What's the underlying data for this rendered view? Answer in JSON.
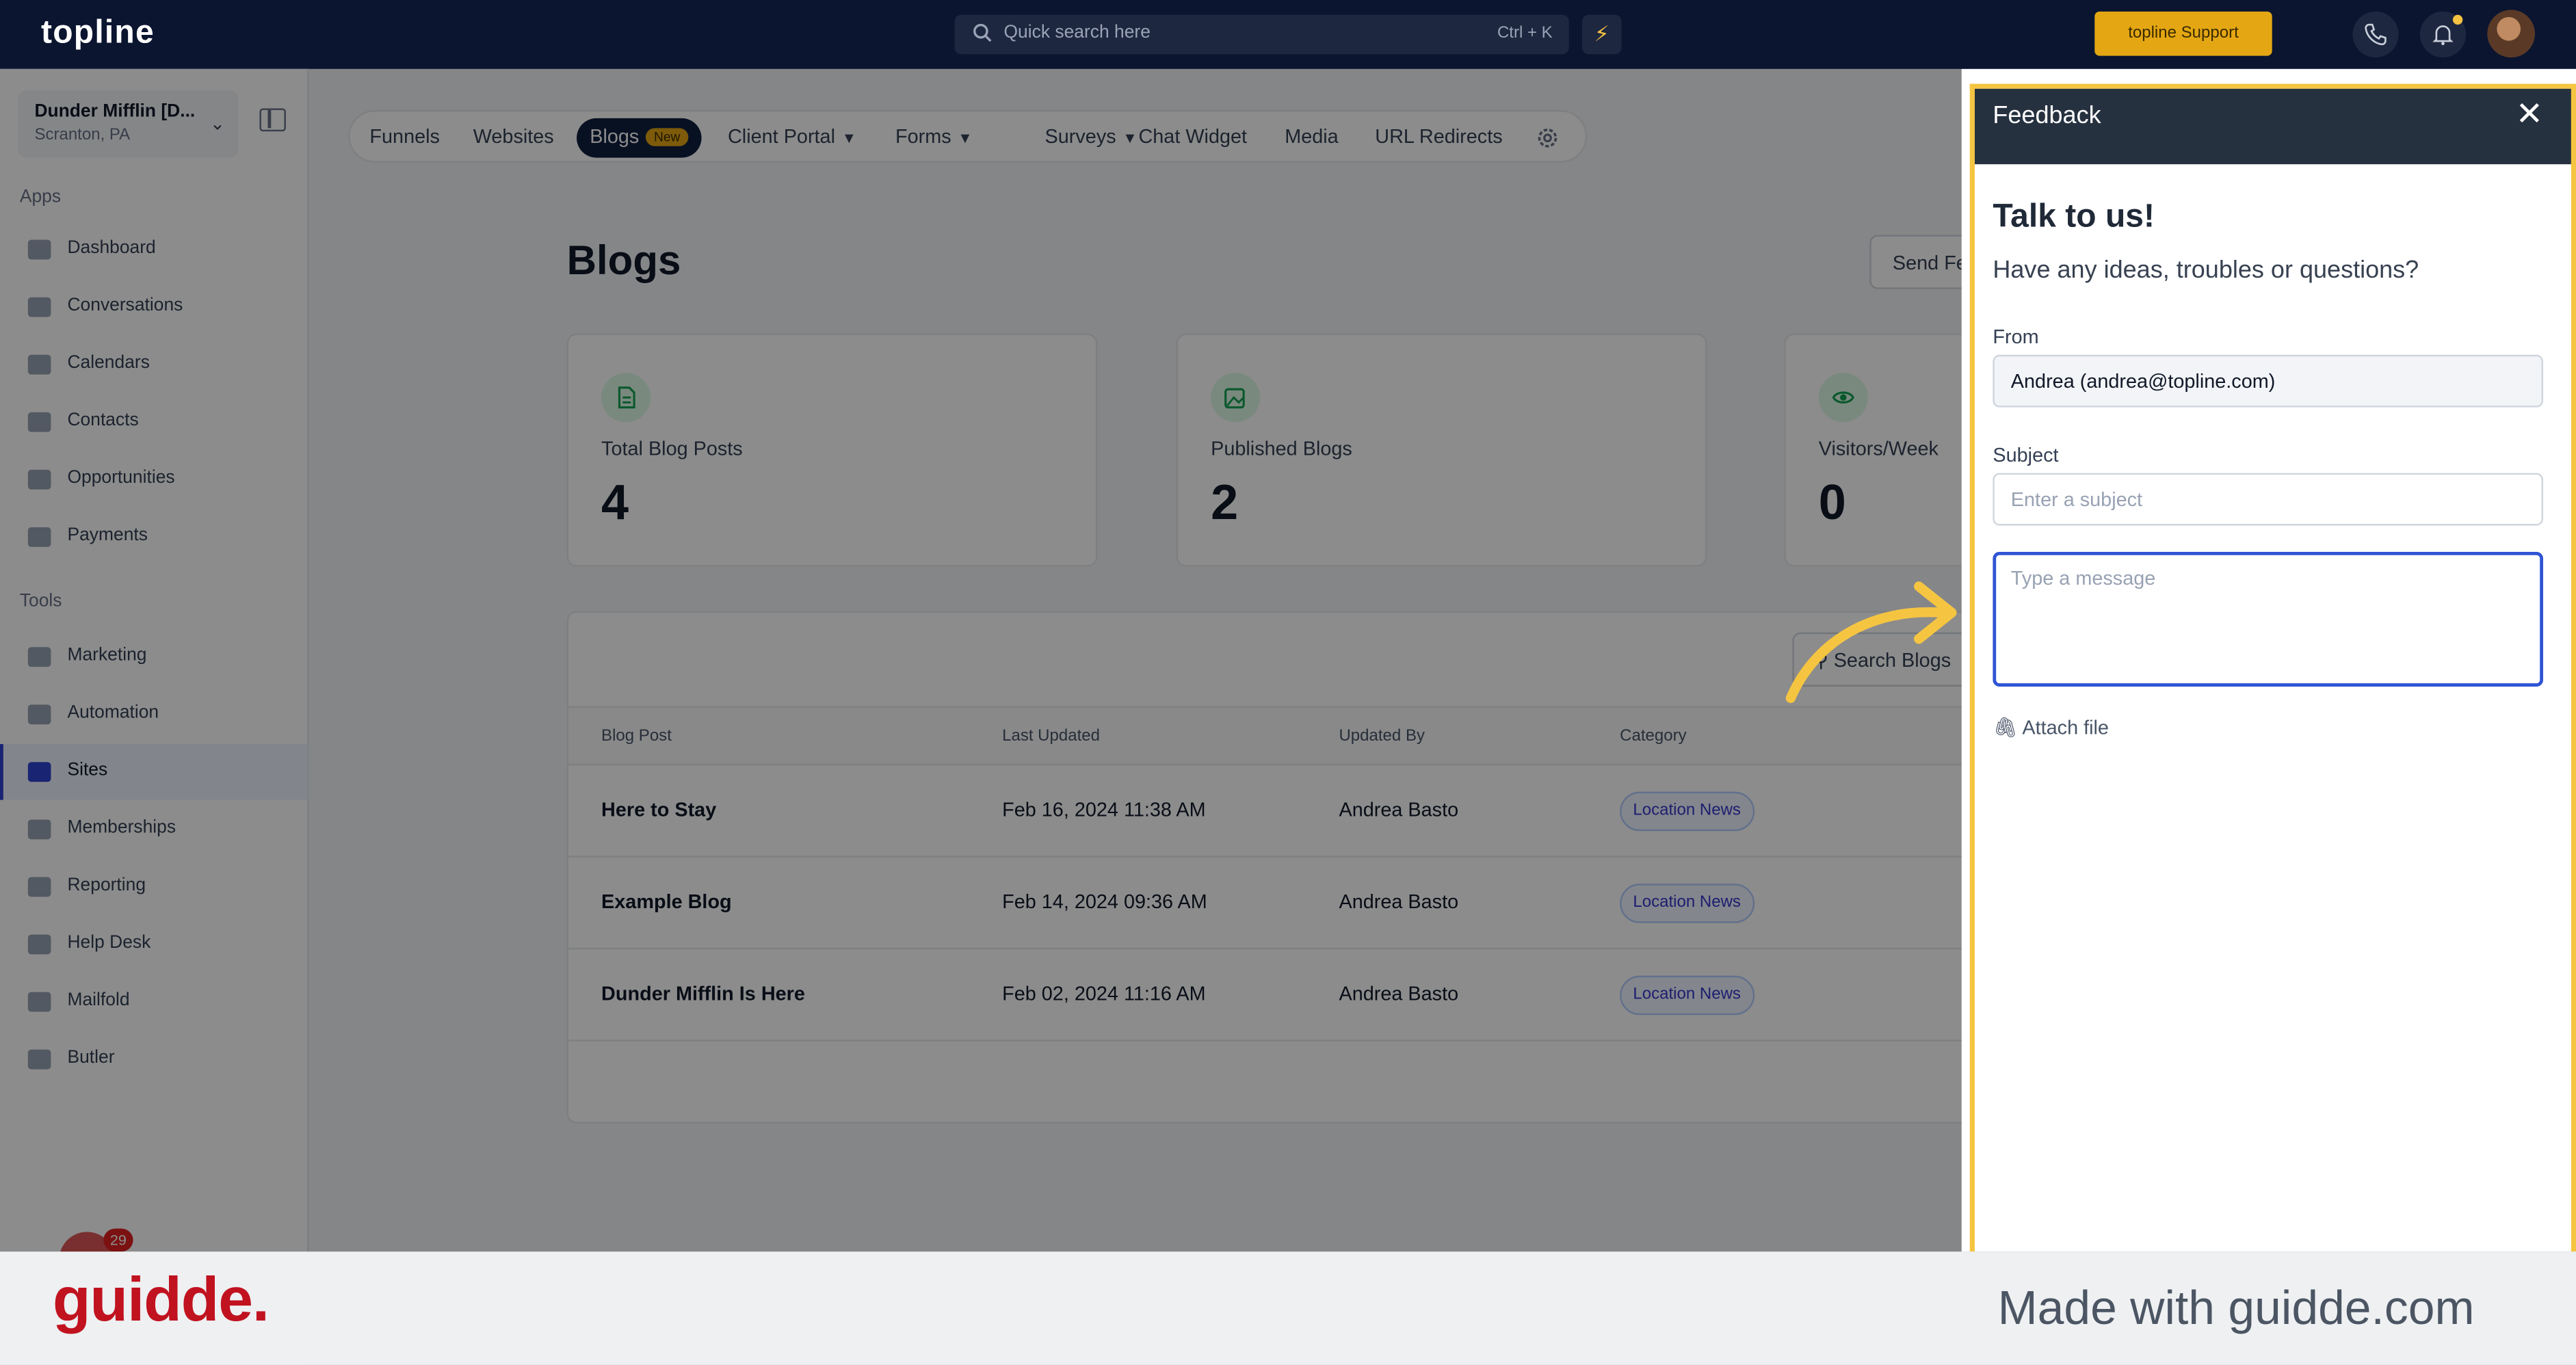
{
  "topbar": {
    "logo": "topline",
    "search_placeholder": "Quick search here",
    "search_shortcut": "Ctrl + K",
    "support_label": "topline Support"
  },
  "sidebar": {
    "location_name": "Dunder Mifflin [D...",
    "location_city": "Scranton, PA",
    "apps_label": "Apps",
    "apps": [
      "Dashboard",
      "Conversations",
      "Calendars",
      "Contacts",
      "Opportunities",
      "Payments"
    ],
    "tools_label": "Tools",
    "tools": [
      "Marketing",
      "Automation",
      "Sites",
      "Memberships",
      "Reporting",
      "Help Desk",
      "Mailfold",
      "Butler"
    ],
    "active_item": "Sites",
    "chat_badge": "29"
  },
  "subnav": {
    "tabs": [
      "Funnels",
      "Websites",
      "Blogs",
      "Client Portal",
      "Forms",
      "Surveys",
      "Chat Widget",
      "Media",
      "URL Redirects"
    ],
    "active_tab": "Blogs",
    "new_badge": "New"
  },
  "main": {
    "title": "Blogs",
    "send_feedback": "Send Fe",
    "stats": [
      {
        "label": "Total Blog Posts",
        "value": "4"
      },
      {
        "label": "Published Blogs",
        "value": "2"
      },
      {
        "label": "Visitors/Week",
        "value": "0"
      }
    ],
    "search_blogs": "Search Blogs",
    "columns": [
      "Blog Post",
      "Last Updated",
      "Updated By",
      "Category"
    ],
    "rows": [
      {
        "post": "Here to Stay",
        "updated": "Feb 16, 2024 11:38 AM",
        "by": "Andrea Basto",
        "category": "Location News"
      },
      {
        "post": "Example Blog",
        "updated": "Feb 14, 2024 09:36 AM",
        "by": "Andrea Basto",
        "category": "Location News"
      },
      {
        "post": "Dunder Mifflin Is Here",
        "updated": "Feb 02, 2024 11:16 AM",
        "by": "Andrea Basto",
        "category": "Location News"
      }
    ]
  },
  "feedback": {
    "header": "Feedback",
    "heading": "Talk to us!",
    "subheading": "Have any ideas, troubles or questions?",
    "from_label": "From",
    "from_value": "Andrea (andrea@topline.com)",
    "subject_label": "Subject",
    "subject_placeholder": "Enter a subject",
    "message_placeholder": "Type a message",
    "attach_label": "Attach file"
  },
  "footer": {
    "brand": "guidde.",
    "made_with": "Made with guidde.com"
  },
  "colors": {
    "highlight": "#f5c542",
    "brand_red": "#c1121f",
    "topbar": "#0b1530",
    "focus_blue": "#2f54d4"
  }
}
